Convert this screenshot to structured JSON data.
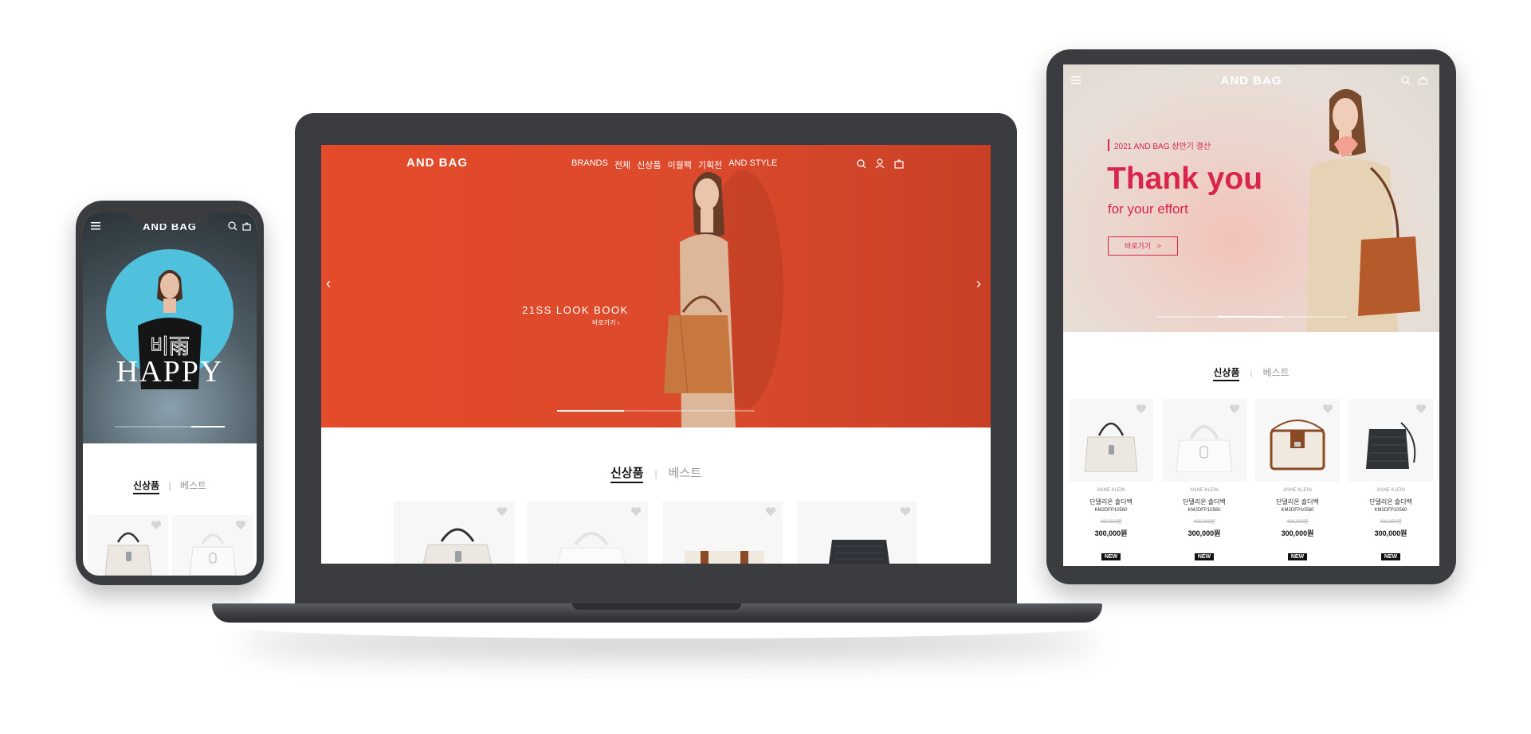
{
  "brand": "AND BAG",
  "colors": {
    "laptop_hero_bg": "#d64a2c",
    "tablet_accent": "#d9254d",
    "device_frame": "#3a3c40",
    "mobile_hero_circle": "#4fc1dc"
  },
  "laptop": {
    "nav": [
      "BRANDS",
      "전체",
      "신상품",
      "이월팩",
      "기획전",
      "AND STYLE"
    ],
    "hero": {
      "title": "21SS LOOK BOOK",
      "link": "바로가기 ›"
    },
    "tabs": {
      "active": "신상품",
      "separator": "|",
      "inactive": "베스트"
    },
    "icons": [
      "search-icon",
      "user-icon",
      "bag-icon"
    ],
    "arrows": {
      "prev": "‹",
      "next": "›"
    }
  },
  "tablet": {
    "hero": {
      "eyebrow": "2021 AND BAG 상반기 결산",
      "title": "Thank you",
      "subtitle": "for your effort",
      "button": "바로가기   >"
    },
    "tabs": {
      "active": "신상품",
      "separator": "|",
      "inactive": "베스트"
    },
    "products": [
      {
        "brand": "ANNE KLEIN",
        "name": "단델리온 숄더백",
        "code": "KM2DFP10560",
        "original_price": "400,000원",
        "price": "300,000원",
        "tag": "NEW"
      },
      {
        "brand": "ANNE KLEIN",
        "name": "단델리온 숄더백",
        "code": "KM2DFP10560",
        "original_price": "400,000원",
        "price": "300,000원",
        "tag": "NEW"
      },
      {
        "brand": "ANNE KLEIN",
        "name": "단델리온 숄더백",
        "code": "KM2DFP10560",
        "original_price": "400,000원",
        "price": "300,000원",
        "tag": "NEW"
      },
      {
        "brand": "ANNE KLEIN",
        "name": "단델리온 숄더백",
        "code": "KM2DFP10560",
        "original_price": "400,000원",
        "price": "300,000원",
        "tag": "NEW"
      }
    ]
  },
  "mobile": {
    "hero": {
      "kr_text": "비雨",
      "title": "HAPPY"
    },
    "tabs": {
      "active": "신상품",
      "separator": "|",
      "inactive": "베스트"
    }
  }
}
